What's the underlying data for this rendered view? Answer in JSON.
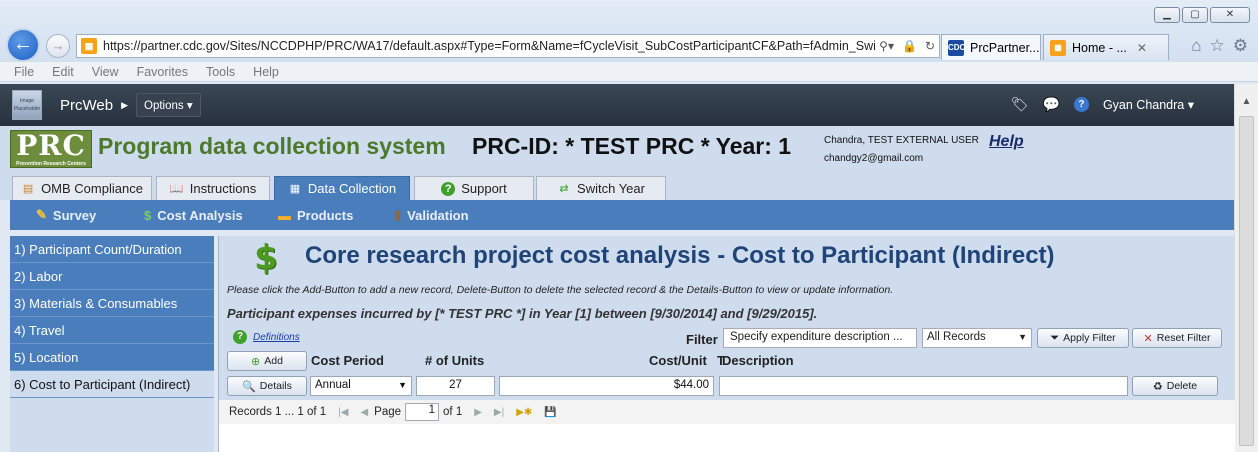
{
  "browser": {
    "url": "https://partner.cdc.gov/Sites/NCCDPHP/PRC/WA17/default.aspx#Type=Form&Name=fCycleVisit_SubCostParticipantCF&Path=fAdmin_SwitchE",
    "tabs": [
      {
        "label": "PrcPartner...",
        "favicon": "CDC"
      },
      {
        "label": "Home - ...",
        "favicon": "PRC"
      }
    ],
    "menu": [
      "File",
      "Edit",
      "View",
      "Favorites",
      "Tools",
      "Help"
    ]
  },
  "app": {
    "name": "PrcWeb",
    "options_label": "Options",
    "logo_text": "Image Placeholder",
    "user_name": "Gyan Chandra"
  },
  "header": {
    "logo": "PRC",
    "logo_sub": "Prevention Research Centers",
    "system_name": "Program data collection system",
    "prc_id": "PRC-ID: * TEST PRC *  Year: 1",
    "user_line1": "Chandra, TEST EXTERNAL USER",
    "user_line2": "chandgy2@gmail.com",
    "help": "Help"
  },
  "main_tabs": [
    {
      "label": "OMB Compliance",
      "icon": "checklist-icon"
    },
    {
      "label": "Instructions",
      "icon": "book-icon"
    },
    {
      "label": "Data Collection",
      "icon": "table-icon"
    },
    {
      "label": "Support",
      "icon": "help-icon"
    },
    {
      "label": "Switch Year",
      "icon": "switch-icon"
    }
  ],
  "sub_nav": [
    "Survey",
    "Cost Analysis",
    "Products",
    "Validation"
  ],
  "left_nav": [
    "1) Participant Count/Duration",
    "2) Labor",
    "3) Materials & Consumables",
    "4) Travel",
    "5) Location",
    "6) Cost to Participant (Indirect)"
  ],
  "content": {
    "title": "Core research project cost analysis - Cost to Participant (Indirect)",
    "instructions": "Please click the Add-Button to add a new record, Delete-Button to delete the selected record & the Details-Button to view or update information.",
    "expenses": "Participant expenses incurred by [* TEST PRC *] in Year [1] between [9/30/2014] and [9/29/2015].",
    "definitions": "Definitions",
    "filter_label": "Filter",
    "filter_placeholder": "Specify expenditure description ...",
    "filter_select": "All Records",
    "apply_filter": "Apply Filter",
    "reset_filter": "Reset Filter",
    "add": "Add",
    "columns": [
      "Cost Period",
      "# of Units",
      "Cost/Unit",
      "T",
      "Description"
    ],
    "row": {
      "details": "Details",
      "cost_period": "Annual",
      "units": "27",
      "cost_unit": "$44.00",
      "description": "",
      "delete": "Delete"
    },
    "pager": {
      "records": "Records 1 ... 1 of 1",
      "page_label": "Page",
      "page_value": "1",
      "of": "of 1"
    }
  }
}
